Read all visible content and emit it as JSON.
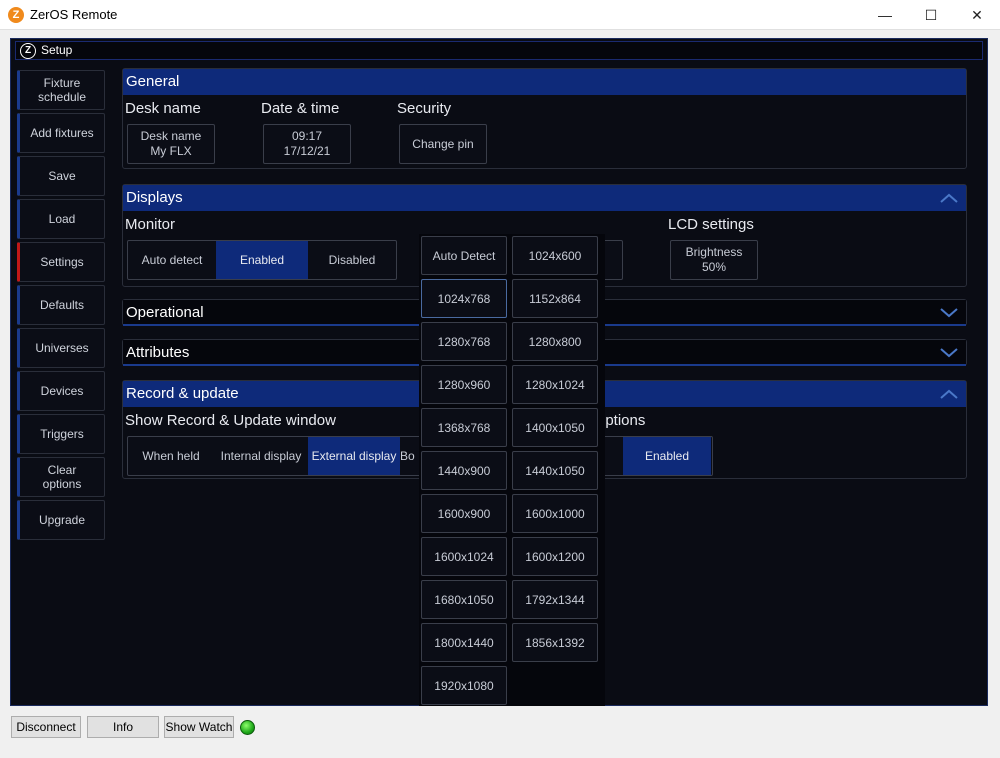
{
  "window": {
    "title": "ZerOS Remote",
    "app_icon": "Z",
    "minimize": "—",
    "maximize": "☐",
    "close": "✕"
  },
  "setup": {
    "title": "Setup",
    "logo": "Z"
  },
  "sidebar": {
    "items": [
      {
        "label": "Fixture schedule"
      },
      {
        "label": "Add fixtures"
      },
      {
        "label": "Save"
      },
      {
        "label": "Load"
      },
      {
        "label": "Settings"
      },
      {
        "label": "Defaults"
      },
      {
        "label": "Universes"
      },
      {
        "label": "Devices"
      },
      {
        "label": "Triggers"
      },
      {
        "label": "Clear options"
      },
      {
        "label": "Upgrade"
      }
    ]
  },
  "general": {
    "title": "General",
    "desk_name_label": "Desk name",
    "desk_name_btn_line1": "Desk name",
    "desk_name_btn_line2": "My FLX",
    "date_time_label": "Date & time",
    "time": "09:17",
    "date": "17/12/21",
    "security_label": "Security",
    "change_pin": "Change pin"
  },
  "displays": {
    "title": "Displays",
    "monitor_label": "Monitor",
    "monitor_options": [
      "Auto detect",
      "Enabled",
      "Disabled"
    ],
    "lcd_label": "LCD settings",
    "brightness_line1": "Brightness",
    "brightness_line2": "50%"
  },
  "operational": {
    "title": "Operational"
  },
  "attributes": {
    "title": "Attributes"
  },
  "record": {
    "title": "Record & update",
    "show_label": "Show Record & Update window",
    "options_label": "options",
    "seg_options": [
      "When held",
      "Internal display",
      "External display"
    ],
    "partial": "Bo",
    "enabled": "Enabled"
  },
  "resolution_dropdown": {
    "col1": [
      "Auto Detect",
      "1024x768",
      "1280x768",
      "1280x960",
      "1368x768",
      "1440x900",
      "1600x900",
      "1600x1024",
      "1680x1050",
      "1800x1440",
      "1920x1080"
    ],
    "col2": [
      "1024x600",
      "1152x864",
      "1280x800",
      "1280x1024",
      "1400x1050",
      "1440x1050",
      "1600x1000",
      "1600x1200",
      "1792x1344",
      "1856x1392"
    ]
  },
  "bottom": {
    "disconnect": "Disconnect",
    "info": "Info",
    "show_watch": "Show Watch"
  }
}
